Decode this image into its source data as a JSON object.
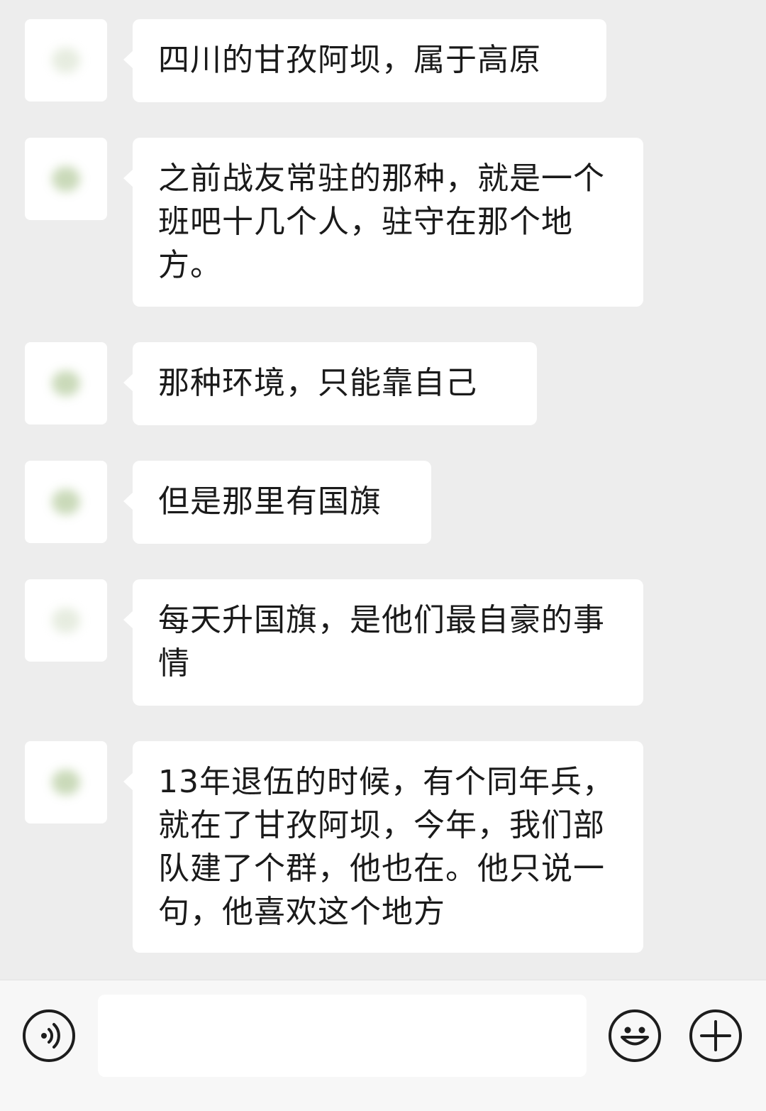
{
  "chat": {
    "messages": [
      {
        "text": "四川的甘孜阿坝，属于高原"
      },
      {
        "text": "之前战友常驻的那种，就是一个班吧十几个人，驻守在那个地方。"
      },
      {
        "text": "那种环境，只能靠自己"
      },
      {
        "text": "但是那里有国旗"
      },
      {
        "text": "每天升国旗，是他们最自豪的事情"
      },
      {
        "text": "13年退伍的时候，有个同年兵，就在了甘孜阿坝，今年，我们部队建了个群，他也在。他只说一句，他喜欢这个地方"
      }
    ]
  },
  "input_bar": {
    "voice_icon": "voice-icon",
    "message_value": "",
    "emoji_icon": "emoji-icon",
    "more_icon": "plus-icon"
  }
}
